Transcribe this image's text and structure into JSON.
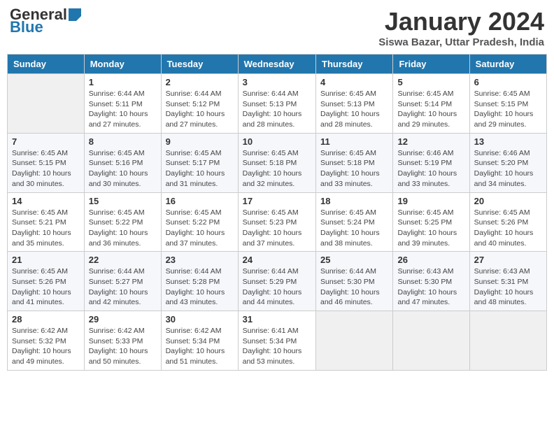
{
  "logo": {
    "general": "General",
    "blue": "Blue"
  },
  "title": {
    "month_year": "January 2024",
    "location": "Siswa Bazar, Uttar Pradesh, India"
  },
  "days_of_week": [
    "Sunday",
    "Monday",
    "Tuesday",
    "Wednesday",
    "Thursday",
    "Friday",
    "Saturday"
  ],
  "weeks": [
    [
      {
        "day": "",
        "sunrise": "",
        "sunset": "",
        "daylight": ""
      },
      {
        "day": "1",
        "sunrise": "Sunrise: 6:44 AM",
        "sunset": "Sunset: 5:11 PM",
        "daylight": "Daylight: 10 hours and 27 minutes."
      },
      {
        "day": "2",
        "sunrise": "Sunrise: 6:44 AM",
        "sunset": "Sunset: 5:12 PM",
        "daylight": "Daylight: 10 hours and 27 minutes."
      },
      {
        "day": "3",
        "sunrise": "Sunrise: 6:44 AM",
        "sunset": "Sunset: 5:13 PM",
        "daylight": "Daylight: 10 hours and 28 minutes."
      },
      {
        "day": "4",
        "sunrise": "Sunrise: 6:45 AM",
        "sunset": "Sunset: 5:13 PM",
        "daylight": "Daylight: 10 hours and 28 minutes."
      },
      {
        "day": "5",
        "sunrise": "Sunrise: 6:45 AM",
        "sunset": "Sunset: 5:14 PM",
        "daylight": "Daylight: 10 hours and 29 minutes."
      },
      {
        "day": "6",
        "sunrise": "Sunrise: 6:45 AM",
        "sunset": "Sunset: 5:15 PM",
        "daylight": "Daylight: 10 hours and 29 minutes."
      }
    ],
    [
      {
        "day": "7",
        "sunrise": "Sunrise: 6:45 AM",
        "sunset": "Sunset: 5:15 PM",
        "daylight": "Daylight: 10 hours and 30 minutes."
      },
      {
        "day": "8",
        "sunrise": "Sunrise: 6:45 AM",
        "sunset": "Sunset: 5:16 PM",
        "daylight": "Daylight: 10 hours and 30 minutes."
      },
      {
        "day": "9",
        "sunrise": "Sunrise: 6:45 AM",
        "sunset": "Sunset: 5:17 PM",
        "daylight": "Daylight: 10 hours and 31 minutes."
      },
      {
        "day": "10",
        "sunrise": "Sunrise: 6:45 AM",
        "sunset": "Sunset: 5:18 PM",
        "daylight": "Daylight: 10 hours and 32 minutes."
      },
      {
        "day": "11",
        "sunrise": "Sunrise: 6:45 AM",
        "sunset": "Sunset: 5:18 PM",
        "daylight": "Daylight: 10 hours and 33 minutes."
      },
      {
        "day": "12",
        "sunrise": "Sunrise: 6:46 AM",
        "sunset": "Sunset: 5:19 PM",
        "daylight": "Daylight: 10 hours and 33 minutes."
      },
      {
        "day": "13",
        "sunrise": "Sunrise: 6:46 AM",
        "sunset": "Sunset: 5:20 PM",
        "daylight": "Daylight: 10 hours and 34 minutes."
      }
    ],
    [
      {
        "day": "14",
        "sunrise": "Sunrise: 6:45 AM",
        "sunset": "Sunset: 5:21 PM",
        "daylight": "Daylight: 10 hours and 35 minutes."
      },
      {
        "day": "15",
        "sunrise": "Sunrise: 6:45 AM",
        "sunset": "Sunset: 5:22 PM",
        "daylight": "Daylight: 10 hours and 36 minutes."
      },
      {
        "day": "16",
        "sunrise": "Sunrise: 6:45 AM",
        "sunset": "Sunset: 5:22 PM",
        "daylight": "Daylight: 10 hours and 37 minutes."
      },
      {
        "day": "17",
        "sunrise": "Sunrise: 6:45 AM",
        "sunset": "Sunset: 5:23 PM",
        "daylight": "Daylight: 10 hours and 37 minutes."
      },
      {
        "day": "18",
        "sunrise": "Sunrise: 6:45 AM",
        "sunset": "Sunset: 5:24 PM",
        "daylight": "Daylight: 10 hours and 38 minutes."
      },
      {
        "day": "19",
        "sunrise": "Sunrise: 6:45 AM",
        "sunset": "Sunset: 5:25 PM",
        "daylight": "Daylight: 10 hours and 39 minutes."
      },
      {
        "day": "20",
        "sunrise": "Sunrise: 6:45 AM",
        "sunset": "Sunset: 5:26 PM",
        "daylight": "Daylight: 10 hours and 40 minutes."
      }
    ],
    [
      {
        "day": "21",
        "sunrise": "Sunrise: 6:45 AM",
        "sunset": "Sunset: 5:26 PM",
        "daylight": "Daylight: 10 hours and 41 minutes."
      },
      {
        "day": "22",
        "sunrise": "Sunrise: 6:44 AM",
        "sunset": "Sunset: 5:27 PM",
        "daylight": "Daylight: 10 hours and 42 minutes."
      },
      {
        "day": "23",
        "sunrise": "Sunrise: 6:44 AM",
        "sunset": "Sunset: 5:28 PM",
        "daylight": "Daylight: 10 hours and 43 minutes."
      },
      {
        "day": "24",
        "sunrise": "Sunrise: 6:44 AM",
        "sunset": "Sunset: 5:29 PM",
        "daylight": "Daylight: 10 hours and 44 minutes."
      },
      {
        "day": "25",
        "sunrise": "Sunrise: 6:44 AM",
        "sunset": "Sunset: 5:30 PM",
        "daylight": "Daylight: 10 hours and 46 minutes."
      },
      {
        "day": "26",
        "sunrise": "Sunrise: 6:43 AM",
        "sunset": "Sunset: 5:30 PM",
        "daylight": "Daylight: 10 hours and 47 minutes."
      },
      {
        "day": "27",
        "sunrise": "Sunrise: 6:43 AM",
        "sunset": "Sunset: 5:31 PM",
        "daylight": "Daylight: 10 hours and 48 minutes."
      }
    ],
    [
      {
        "day": "28",
        "sunrise": "Sunrise: 6:42 AM",
        "sunset": "Sunset: 5:32 PM",
        "daylight": "Daylight: 10 hours and 49 minutes."
      },
      {
        "day": "29",
        "sunrise": "Sunrise: 6:42 AM",
        "sunset": "Sunset: 5:33 PM",
        "daylight": "Daylight: 10 hours and 50 minutes."
      },
      {
        "day": "30",
        "sunrise": "Sunrise: 6:42 AM",
        "sunset": "Sunset: 5:34 PM",
        "daylight": "Daylight: 10 hours and 51 minutes."
      },
      {
        "day": "31",
        "sunrise": "Sunrise: 6:41 AM",
        "sunset": "Sunset: 5:34 PM",
        "daylight": "Daylight: 10 hours and 53 minutes."
      },
      {
        "day": "",
        "sunrise": "",
        "sunset": "",
        "daylight": ""
      },
      {
        "day": "",
        "sunrise": "",
        "sunset": "",
        "daylight": ""
      },
      {
        "day": "",
        "sunrise": "",
        "sunset": "",
        "daylight": ""
      }
    ]
  ]
}
